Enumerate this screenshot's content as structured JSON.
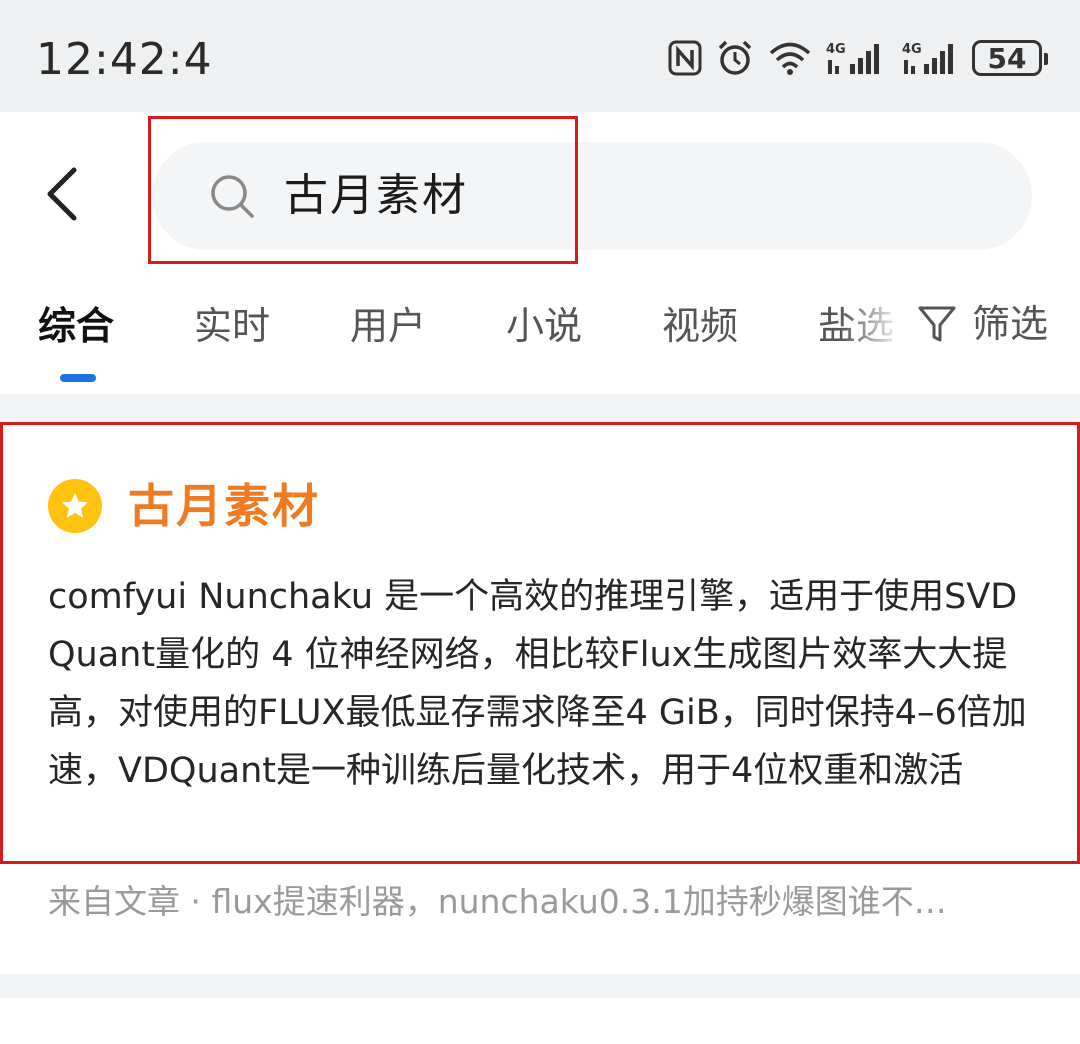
{
  "status_bar": {
    "time": "12:42:4",
    "battery": "54",
    "icons": [
      "nfc-icon",
      "alarm-icon",
      "wifi-icon",
      "signal-4g-icon",
      "signal-4g-icon"
    ]
  },
  "search": {
    "query": "古月素材",
    "icon": "search-icon"
  },
  "tabs": [
    {
      "label": "综合",
      "active": true
    },
    {
      "label": "实时",
      "active": false
    },
    {
      "label": "用户",
      "active": false
    },
    {
      "label": "小说",
      "active": false
    },
    {
      "label": "视频",
      "active": false
    },
    {
      "label": "盐选",
      "active": false
    }
  ],
  "filter": {
    "label": "筛选",
    "icon": "filter-icon"
  },
  "result": {
    "title": "古月素材",
    "badge_icon": "star-icon",
    "body": "comfyui Nunchaku 是一个高效的推理引擎，适用于使用SVDQuant量化的 4 位神经网络，相比较Flux生成图片效率大大提高，对使用的FLUX最低显存需求降至4 GiB，同时保持4–6倍加速，VDQuant是一种训练后量化技术，用于4位权重和激活",
    "source": "来自文章 · flux提速利器，nunchaku0.3.1加持秒爆图谁不…"
  },
  "colors": {
    "accent_blue": "#1f6fe6",
    "title_orange": "#f07a22",
    "star_yellow": "#ffc20e",
    "highlight_red": "#d71a1a"
  }
}
